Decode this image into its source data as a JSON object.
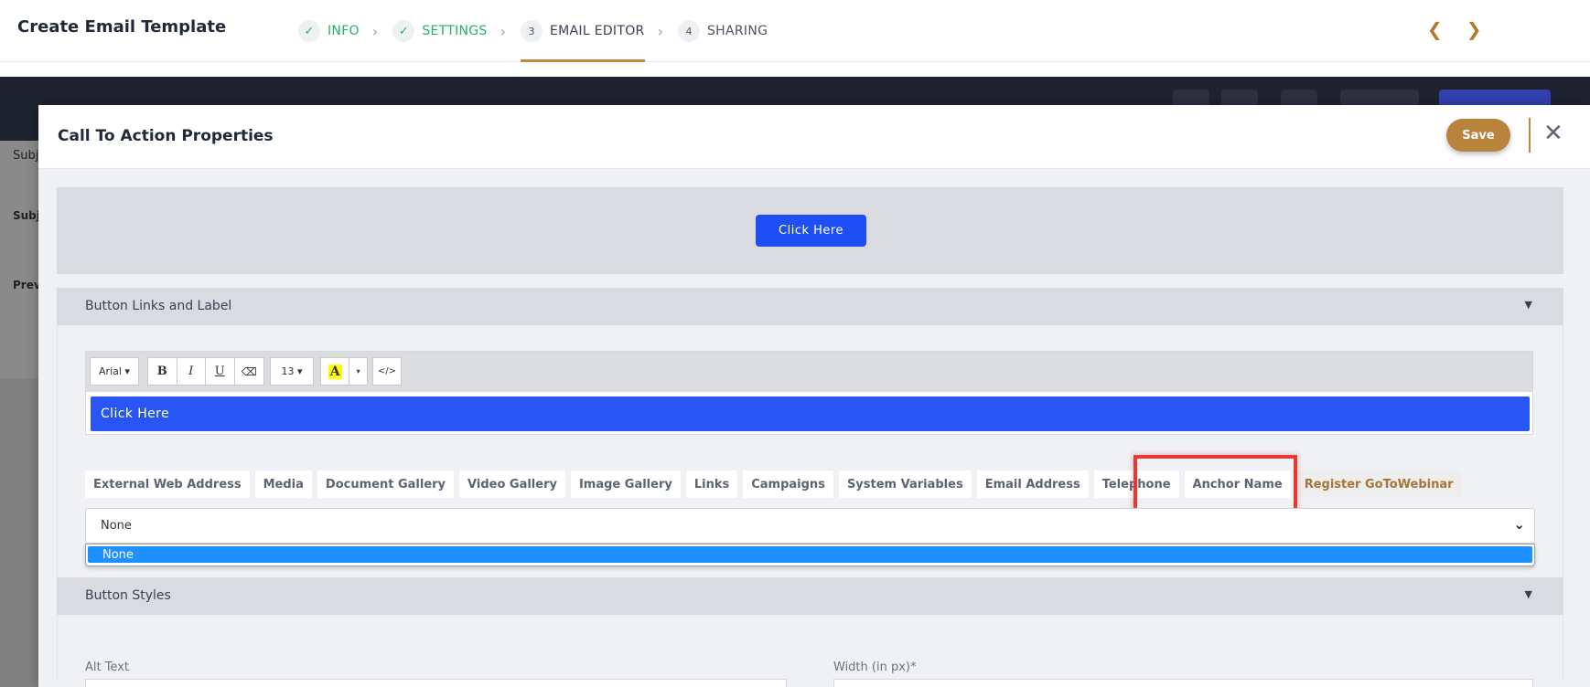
{
  "header": {
    "title": "Create Email Template",
    "steps": [
      {
        "marker": "✓",
        "label": "INFO",
        "state": "done"
      },
      {
        "marker": "✓",
        "label": "SETTINGS",
        "state": "done"
      },
      {
        "marker": "3",
        "label": "EMAIL EDITOR",
        "state": "current"
      },
      {
        "marker": "4",
        "label": "SHARING",
        "state": "todo"
      }
    ],
    "prev_icon": "chevron-left-icon",
    "next_icon": "chevron-right-icon"
  },
  "background": {
    "labels": [
      "Subj",
      "Subj",
      "Prev"
    ]
  },
  "modal": {
    "title": "Call To Action Properties",
    "save_label": "Save",
    "close_icon": "close-icon",
    "preview_button_label": "Click Here",
    "links_section_title": "Button Links and Label",
    "styles_section_title": "Button Styles",
    "toolbar": {
      "font": "Arial ▾",
      "bold": "B",
      "italic": "I",
      "underline": "U",
      "clear_icon": "eraser-icon",
      "size": "13 ▾",
      "color": "A",
      "color_caret": "▾",
      "code": "</>"
    },
    "editor_content": "Click Here",
    "link_tabs": [
      "External Web Address",
      "Media",
      "Document Gallery",
      "Video Gallery",
      "Image Gallery",
      "Links",
      "Campaigns",
      "System Variables",
      "Email Address",
      "Telephone",
      "Anchor Name",
      "Register GoToWebinar"
    ],
    "active_link_tab": "Register GoToWebinar",
    "select_value": "None",
    "dropdown_options": [
      "None"
    ],
    "alt_text_label": "Alt Text",
    "width_label": "Width (in px)*"
  },
  "colors": {
    "accent": "#b8843b",
    "primary_blue": "#1d4ff5",
    "success": "#22b35f",
    "highlight": "#e53935"
  }
}
